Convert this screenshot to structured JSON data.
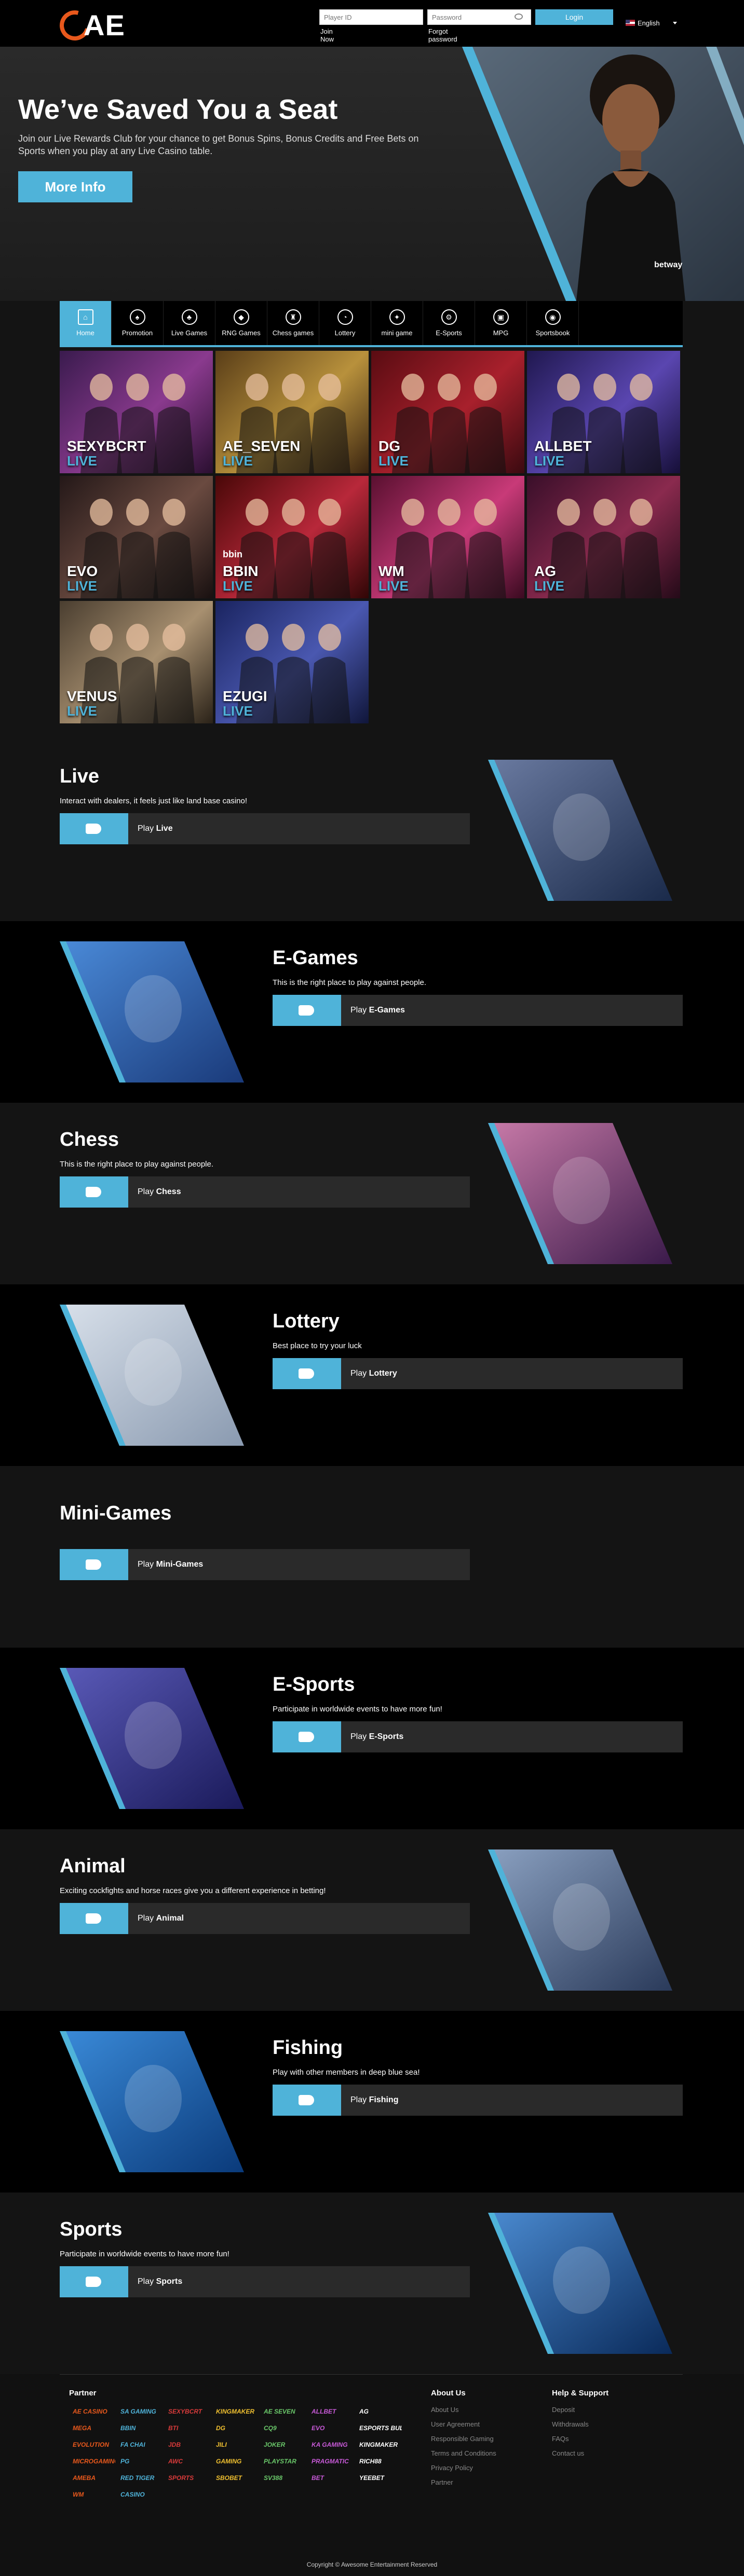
{
  "header": {
    "logo_text": "AE",
    "player_id_placeholder": "Player ID",
    "password_placeholder": "Password",
    "login_label": "Login",
    "join_label": "Join Now",
    "forgot_label": "Forgot password",
    "language": "English"
  },
  "hero": {
    "title": "We’ve Saved You a Seat",
    "subtitle": "Join our Live Rewards Club for your chance to get Bonus Spins, Bonus Credits and Free Bets on Sports when you play at any Live Casino table.",
    "button": "More Info",
    "shirt_text": "betway"
  },
  "categories": [
    {
      "label": "Home",
      "icon": "home-icon"
    },
    {
      "label": "Promotion",
      "icon": "promotion-icon"
    },
    {
      "label": "Live Games",
      "icon": "live-games-icon"
    },
    {
      "label": "RNG Games",
      "icon": "rng-games-icon"
    },
    {
      "label": "Chess games",
      "icon": "chess-icon"
    },
    {
      "label": "Lottery",
      "icon": "lottery-icon"
    },
    {
      "label": "mini game",
      "icon": "mini-game-icon"
    },
    {
      "label": "E-Sports",
      "icon": "esports-icon"
    },
    {
      "label": "MPG",
      "icon": "mpg-icon"
    },
    {
      "label": "Sportsbook",
      "icon": "sportsbook-icon"
    }
  ],
  "live_tiles": [
    {
      "name": "SEXYBCRT",
      "live": "LIVE",
      "logo": ""
    },
    {
      "name": "AE_SEVEN",
      "live": "LIVE",
      "logo": ""
    },
    {
      "name": "DG",
      "live": "LIVE",
      "logo": ""
    },
    {
      "name": "ALLBET",
      "live": "LIVE",
      "logo": ""
    },
    {
      "name": "EVO",
      "live": "LIVE",
      "logo": ""
    },
    {
      "name": "BBIN",
      "live": "LIVE",
      "logo": "bbin"
    },
    {
      "name": "WM",
      "live": "LIVE",
      "logo": ""
    },
    {
      "name": "AG",
      "live": "LIVE",
      "logo": ""
    },
    {
      "name": "VENUS",
      "live": "LIVE",
      "logo": ""
    },
    {
      "name": "EZUGI",
      "live": "LIVE",
      "logo": ""
    }
  ],
  "sections": [
    {
      "title": "Live",
      "desc": "Interact with dealers, it feels just like land base casino!",
      "play_prefix": "Play",
      "play_name": "Live"
    },
    {
      "title": "E-Games",
      "desc": "This is the right place to play against people.",
      "play_prefix": "Play",
      "play_name": "E-Games"
    },
    {
      "title": "Chess",
      "desc": "This is the right place to play against people.",
      "play_prefix": "Play",
      "play_name": "Chess"
    },
    {
      "title": "Lottery",
      "desc": "Best place to try your luck",
      "play_prefix": "Play",
      "play_name": "Lottery"
    },
    {
      "title": "Mini-Games",
      "desc": "",
      "play_prefix": "Play",
      "play_name": "Mini-Games"
    },
    {
      "title": "E-Sports",
      "desc": "Participate in worldwide events to have more fun!",
      "play_prefix": "Play",
      "play_name": "E-Sports"
    },
    {
      "title": "Animal",
      "desc": "Exciting cockfights and horse races give you a different experience in betting!",
      "play_prefix": "Play",
      "play_name": "Animal"
    },
    {
      "title": "Fishing",
      "desc": "Play with other members in deep blue sea!",
      "play_prefix": "Play",
      "play_name": "Fishing"
    },
    {
      "title": "Sports",
      "desc": "Participate in worldwide events to have more fun!",
      "play_prefix": "Play",
      "play_name": "Sports"
    }
  ],
  "footer": {
    "partner_title": "Partner",
    "partners": [
      "AE CASINO",
      "SA GAMING",
      "SEXYBCRT",
      "KINGMAKER",
      "AE SEVEN",
      "ALLBET",
      "AG",
      "MEGA",
      "BBIN",
      "BTI",
      "DG",
      "CQ9",
      "EVO",
      "ESPORTS BULL",
      "EVOLUTION",
      "FA CHAI",
      "JDB",
      "JILI",
      "JOKER",
      "KA GAMING",
      "KINGMAKER",
      "MICROGAMING",
      "PG",
      "AWC",
      "GAMING",
      "PLAYSTAR",
      "PRAGMATIC",
      "RICH88",
      "AMEBA",
      "RED TIGER",
      "SPORTS",
      "SBOBET",
      "SV388",
      "BET",
      "YEEBET",
      "WM",
      "CASINO"
    ],
    "about_title": "About Us",
    "about_links": [
      "About Us",
      "User Agreement",
      "Responsible Gaming",
      "Terms and Conditions",
      "Privacy Policy",
      "Partner"
    ],
    "help_title": "Help & Support",
    "help_links": [
      "Deposit",
      "Withdrawals",
      "FAQs",
      "Contact us"
    ],
    "copyright": "Copyright © Awesome Entertainment Reserved"
  },
  "colors": {
    "accent": "#4fb3d9",
    "logo_orange": "#e8581c",
    "dark": "#000000",
    "panel": "#141414"
  }
}
